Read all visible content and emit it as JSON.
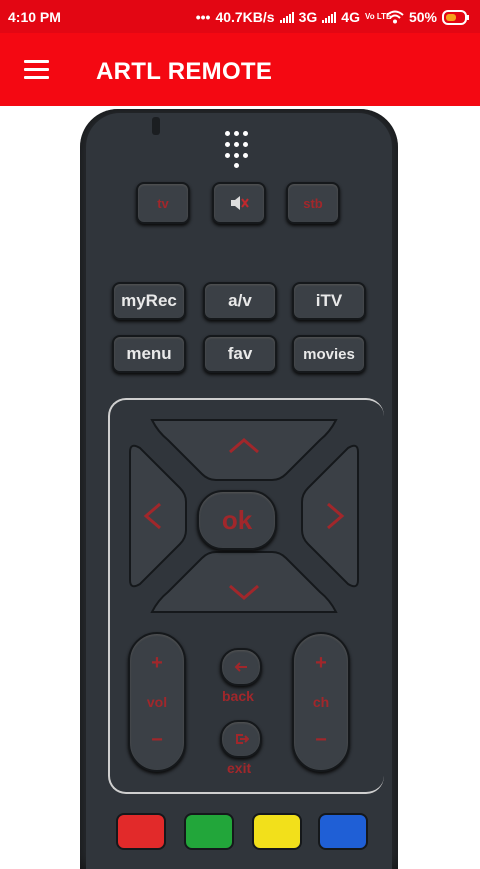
{
  "status": {
    "time": "4:10 PM",
    "dots": "•••",
    "speed": "40.7KB/s",
    "net1": "3G",
    "net2": "4G",
    "volte": "Vo LTE",
    "battery": "50%"
  },
  "appbar": {
    "title": "ARTL REMOTE"
  },
  "remote": {
    "top_row": [
      "tv",
      "",
      "stb"
    ],
    "row1": [
      "myRec",
      "a/v",
      "iTV"
    ],
    "row2": [
      "menu",
      "fav",
      "movies"
    ],
    "dpad": {
      "ok": "ok"
    },
    "vol": {
      "plus": "+",
      "label": "vol",
      "minus": "−"
    },
    "ch": {
      "plus": "+",
      "label": "ch",
      "minus": "−"
    },
    "back_label": "back",
    "exit_label": "exit",
    "colors": [
      "#e22a2a",
      "#22a63a",
      "#f2e01b",
      "#1f5fd6"
    ]
  }
}
